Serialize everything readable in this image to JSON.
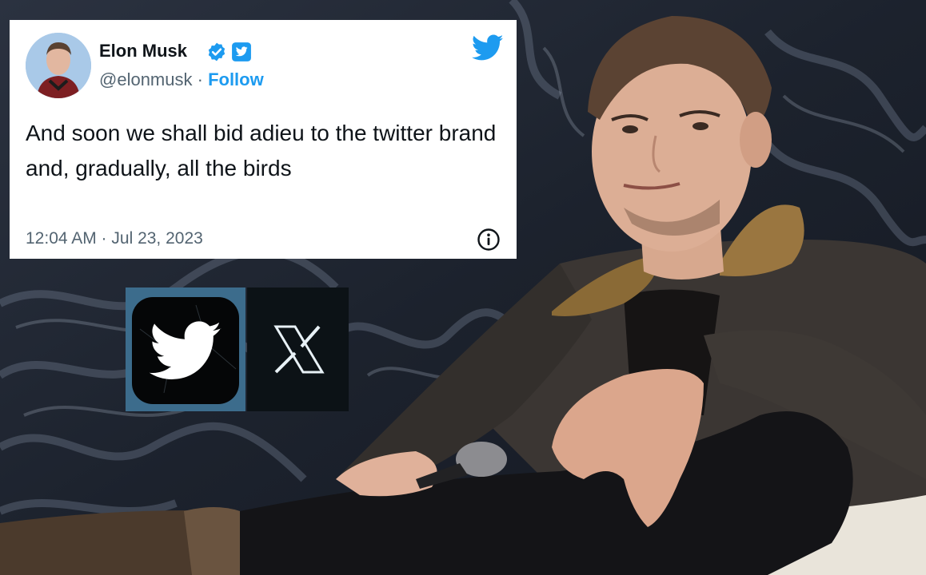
{
  "tweet": {
    "author_name": "Elon Musk",
    "handle": "@elonmusk",
    "separator": " · ",
    "follow_label": "Follow",
    "text": "And soon we shall bid adieu to the twitter brand and, gradually, all the birds",
    "timestamp": "12:04 AM · Jul 23, 2023"
  },
  "icons": {
    "brand": "twitter-bird-icon",
    "verified": "verified-badge-icon",
    "twitter_blue": "twitter-blue-icon",
    "info": "info-icon"
  },
  "colors": {
    "twitter_blue": "#1d9bf0",
    "text_primary": "#0f1419",
    "text_secondary": "#536471"
  },
  "logos": {
    "old": "twitter-bird-logo",
    "new": "x-logo"
  }
}
